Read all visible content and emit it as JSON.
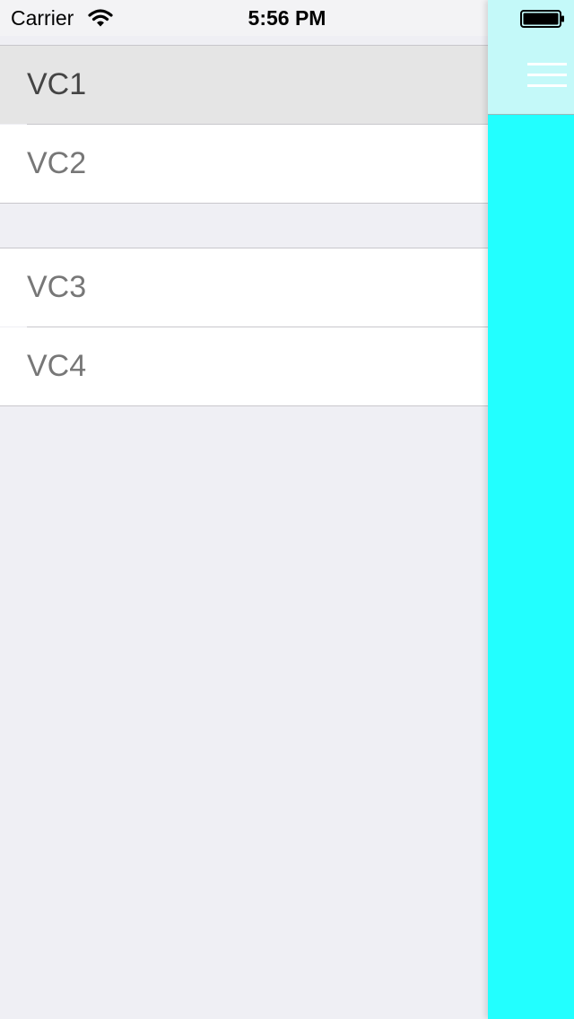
{
  "status_bar": {
    "carrier": "Carrier",
    "time": "5:56 PM",
    "wifi_icon": "wifi-icon",
    "battery_icon": "battery-icon"
  },
  "menu": {
    "sections": [
      {
        "items": [
          {
            "label": "VC1",
            "selected": true
          },
          {
            "label": "VC2",
            "selected": false
          }
        ]
      },
      {
        "items": [
          {
            "label": "VC3",
            "selected": false
          },
          {
            "label": "VC4",
            "selected": false
          }
        ]
      }
    ]
  },
  "content": {
    "background_color": "#22ffff",
    "navbar_color": "#c4f9f9",
    "menu_button_icon": "hamburger-icon"
  },
  "colors": {
    "table_background": "#efeff4",
    "selected_row": "#e5e5e5",
    "separator": "#c8c7cc"
  }
}
